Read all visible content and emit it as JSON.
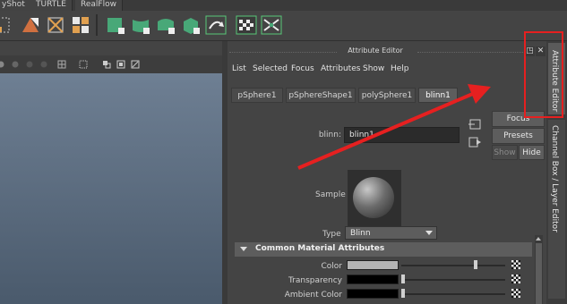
{
  "shelf_tabs": [
    "yShot",
    "TURTLE",
    "RealFlow"
  ],
  "shelf_icons": [
    "joint-tool-icon",
    "poly-cube-shatter-icon",
    "cross-box-icon",
    "block-grid-icon",
    "poly-shape-a-icon",
    "poly-shape-b-icon",
    "poly-shape-c-icon",
    "poly-shape-d-icon",
    "poly-shape-e-icon",
    "bridge-arrow-icon",
    "checker-script-icon",
    "crossed-bones-icon"
  ],
  "viewport_tools": [
    "circle-icon",
    "circle-icon",
    "circle-icon",
    "circle-icon",
    "grid-icon",
    "select-icon",
    "frame-icon",
    "frame-icon",
    "frame-icon"
  ],
  "attribute_editor": {
    "title": "Attribute Editor",
    "menu": [
      "List",
      "Selected",
      "Focus",
      "Attributes",
      "Show",
      "Help"
    ],
    "tabs": [
      {
        "label": "pSphere1",
        "active": false
      },
      {
        "label": "pSphereShape1",
        "active": false
      },
      {
        "label": "polySphere1",
        "active": false
      },
      {
        "label": "blinn1",
        "active": true
      }
    ],
    "node_label": "blinn:",
    "node_name": "blinn1",
    "buttons": {
      "focus": "Focus",
      "presets": "Presets",
      "show": "Show",
      "hide": "Hide"
    },
    "sample_label": "Sample",
    "type_label": "Type",
    "type_value": "Blinn",
    "section_title": "Common Material Attributes",
    "attributes": [
      {
        "label": "Color",
        "swatch": "#b4b4b4",
        "slider": 0.72
      },
      {
        "label": "Transparency",
        "swatch": "#000000",
        "slider": 0.0
      },
      {
        "label": "Ambient Color",
        "swatch": "#000000",
        "slider": 0.0
      }
    ]
  },
  "dock_tabs": [
    "Attribute Editor",
    "Channel Box / Layer Editor"
  ],
  "colors": {
    "annotation_red": "#e62020",
    "panel": "#444444",
    "active_tab": "#5d5d5d"
  }
}
